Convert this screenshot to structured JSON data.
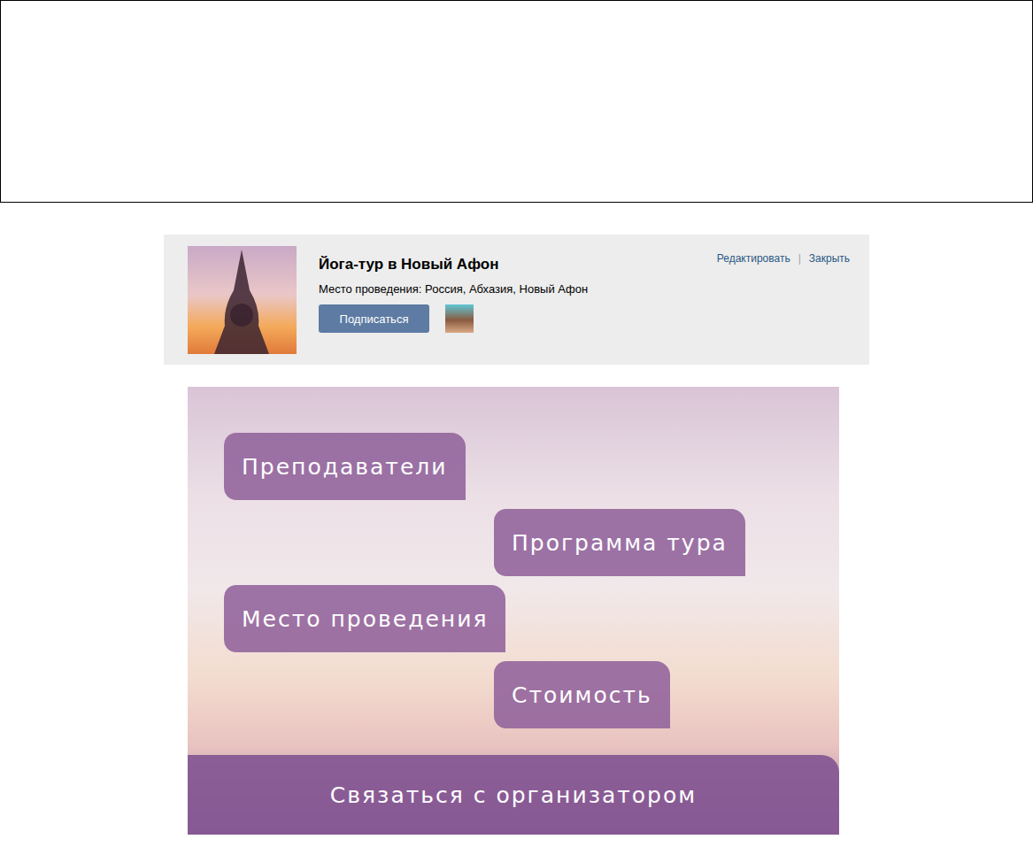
{
  "group": {
    "title": "Йога-тур в Новый Афон",
    "location": "Место проведения: Россия, Абхазия, Новый Афон",
    "subscribe_button": "Подписаться",
    "actions": [
      "Редактировать",
      "Закрыть"
    ],
    "separator": "|"
  },
  "menu": {
    "items": [
      {
        "label": "Преподаватели"
      },
      {
        "label": "Программа тура"
      },
      {
        "label": "Место проведения"
      },
      {
        "label": "Стоимость"
      }
    ],
    "contact": "Связаться с организатором"
  }
}
